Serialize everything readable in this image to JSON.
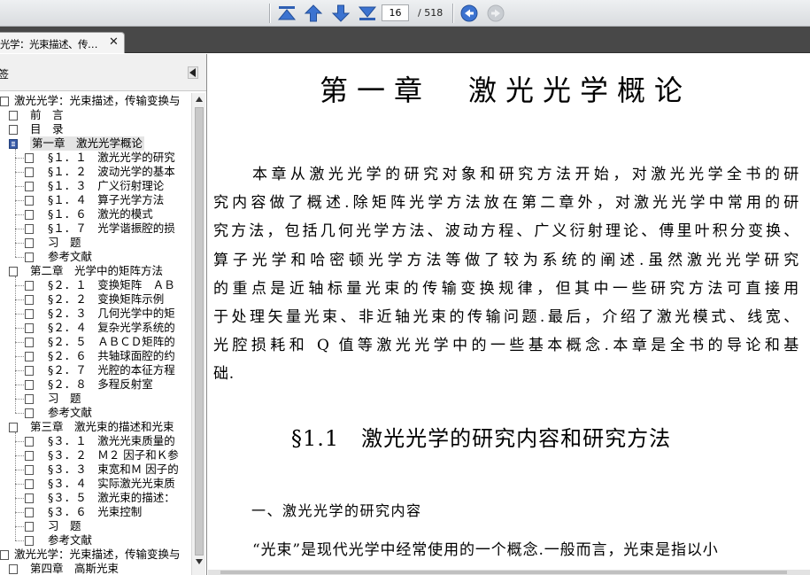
{
  "toolbar": {
    "current_page": "16",
    "total_pages": "/ 518",
    "buttons": [
      "first-page",
      "previous-page",
      "next-page",
      "last-page",
      "back",
      "forward"
    ]
  },
  "tab": {
    "label": "光学：光束描述、传…",
    "close": "✕"
  },
  "sidebar": {
    "title": "签",
    "collapse_icon": "triangle-left-icon",
    "tree": [
      {
        "label": "激光光学：光束描述，传输变换与",
        "level": 0
      },
      {
        "label": "前　言",
        "level": 1
      },
      {
        "label": "目　录",
        "level": 1
      },
      {
        "label": "第一章　激光光学概论",
        "level": 1,
        "selected": true
      },
      {
        "label": "§１．１　激光光学的研究",
        "level": 2
      },
      {
        "label": "§１．２　波动光学的基本",
        "level": 2
      },
      {
        "label": "§１．３　广义衍射理论",
        "level": 2
      },
      {
        "label": "§１．４　算子光学方法",
        "level": 2
      },
      {
        "label": "§１．６　激光的模式",
        "level": 2
      },
      {
        "label": "§１．７　光学谐振腔的损",
        "level": 2
      },
      {
        "label": "习　题",
        "level": 2
      },
      {
        "label": "参考文献",
        "level": 2
      },
      {
        "label": "第二章　光学中的矩阵方法",
        "level": 1
      },
      {
        "label": "§２．１　变换矩阵　ＡＢ",
        "level": 2
      },
      {
        "label": "§２．２　变换矩阵示例",
        "level": 2
      },
      {
        "label": "§２．３　几何光学中的矩",
        "level": 2
      },
      {
        "label": "§２．４　复杂光学系统的",
        "level": 2
      },
      {
        "label": "§２．５　ＡＢＣＤ矩阵的",
        "level": 2
      },
      {
        "label": "§２．６　共轴球面腔的约",
        "level": 2
      },
      {
        "label": "§２．７　光腔的本征方程",
        "level": 2
      },
      {
        "label": "§２．８　多程反射室",
        "level": 2
      },
      {
        "label": "习　题",
        "level": 2
      },
      {
        "label": "参考文献",
        "level": 2
      },
      {
        "label": "第三章　激光束的描述和光束",
        "level": 1
      },
      {
        "label": "§３．１　激光光束质量的",
        "level": 2
      },
      {
        "label": "§３．２　Ｍ２ 因子和Ｋ参",
        "level": 2
      },
      {
        "label": "§３．３　束宽和Ｍ 因子的",
        "level": 2
      },
      {
        "label": "§３．４　实际激光光束质",
        "level": 2
      },
      {
        "label": "§３．５　激光束的描述：",
        "level": 2
      },
      {
        "label": "§３．６　光束控制",
        "level": 2
      },
      {
        "label": "习　题",
        "level": 2
      },
      {
        "label": "参考文献",
        "level": 2
      },
      {
        "label": "激光光学：光束描述，传输变换与",
        "level": 0
      },
      {
        "label": "第四章　高斯光束",
        "level": 1
      }
    ]
  },
  "document": {
    "chapter_title": "第一章　激光光学概论",
    "intro_lines": [
      "本章从激光光学的研究对象和研究方法开始，对激光光学全书的研",
      "究内容做了概述.除矩阵光学方法放在第二章外，对激光光学中常用的研",
      "究方法，包括几何光学方法、波动方程、广义衍射理论、傅里叶积分变换、",
      "算子光学和哈密顿光学方法等做了较为系统的阐述.虽然激光光学研究",
      "的重点是近轴标量光束的传输变换规律，但其中一些研究方法可直接用",
      "于处理矢量光束、非近轴光束的传输问题.最后，介绍了激光模式、线宽、",
      "光腔损耗和 Q 值等激光光学中的一些基本概念.本章是全书的导论和基",
      "础."
    ],
    "section_title": "§1.1　激光光学的研究内容和研究方法",
    "subsection_title": "一、激光光学的研究内容",
    "last_line": "“光束”是现代光学中经常使用的一个概念.一般而言，光束是指以小"
  },
  "colors": {
    "toolbar_icon": "#2f5fb3",
    "tabstrip": "#484848",
    "selected_node": "#3a5ca8"
  }
}
